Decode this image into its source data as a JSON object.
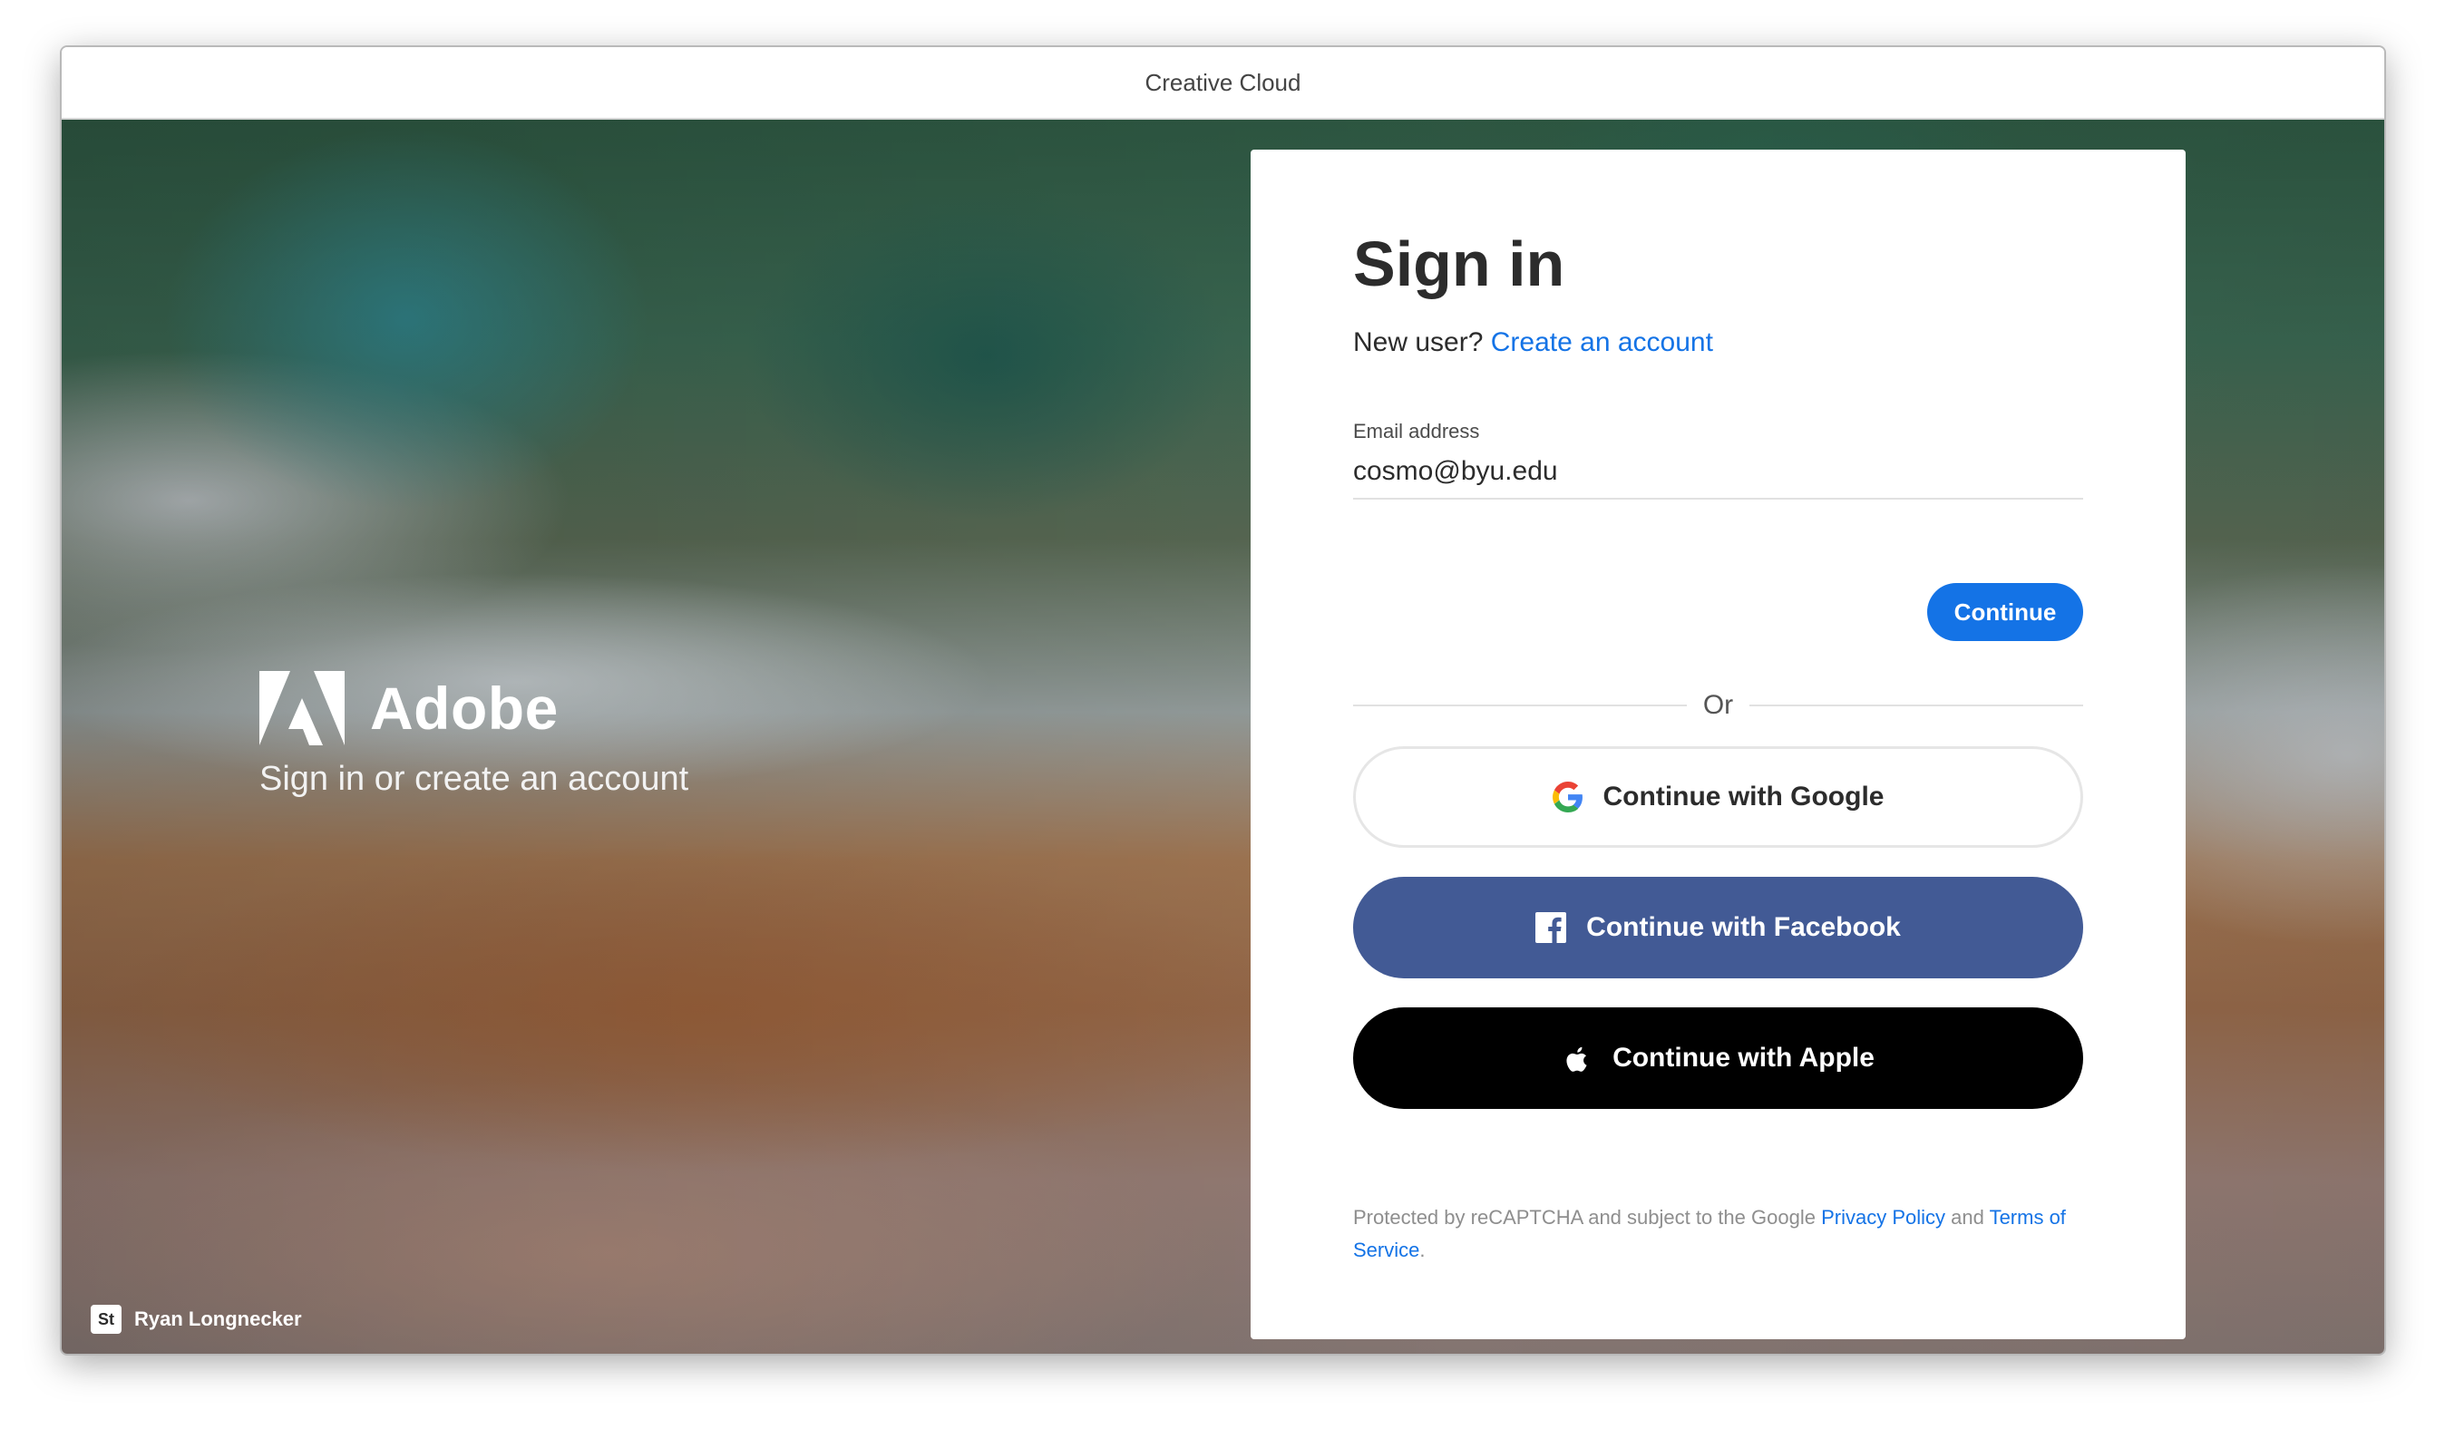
{
  "window": {
    "title": "Creative Cloud"
  },
  "brand": {
    "name": "Adobe",
    "tagline": "Sign in or create an account",
    "logo_icon": "adobe-logo-icon"
  },
  "credit": {
    "badge": "St",
    "author": "Ryan Longnecker"
  },
  "signin": {
    "heading": "Sign in",
    "new_user_prefix": "New user?",
    "create_account_link": "Create an account",
    "email_label": "Email address",
    "email_value": "cosmo@byu.edu",
    "continue_label": "Continue",
    "divider_text": "Or",
    "google_label": "Continue with Google",
    "facebook_label": "Continue with Facebook",
    "apple_label": "Continue with Apple"
  },
  "legal": {
    "prefix": "Protected by reCAPTCHA and subject to the Google",
    "privacy_link": "Privacy Policy",
    "conjunction": "and",
    "terms_link": "Terms of Service",
    "suffix": "."
  },
  "colors": {
    "accent": "#1473e6",
    "facebook": "#425a95",
    "apple": "#000000"
  }
}
